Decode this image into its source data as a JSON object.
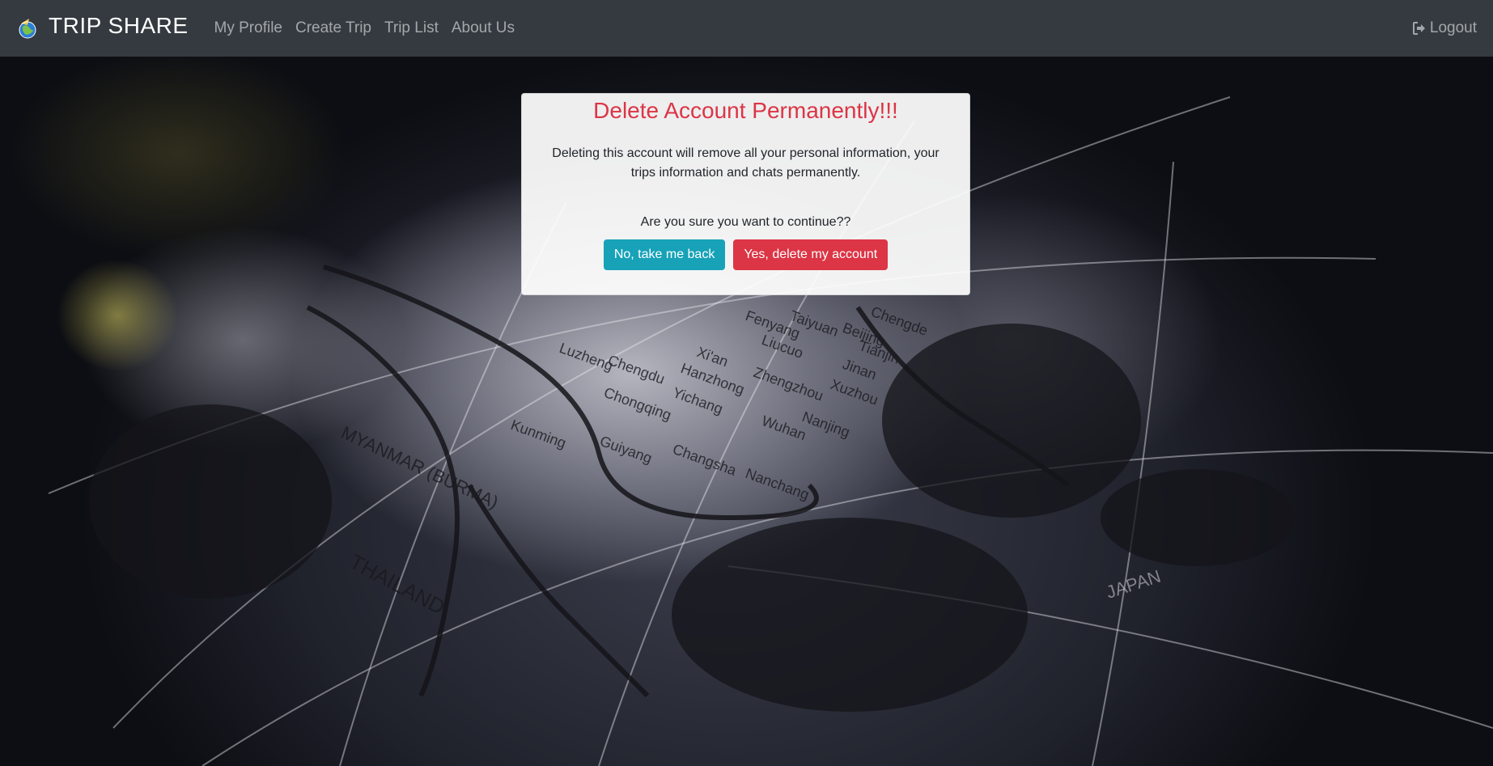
{
  "navbar": {
    "brand": "TRIP SHARE",
    "links": [
      {
        "label": "My Profile"
      },
      {
        "label": "Create Trip"
      },
      {
        "label": "Trip List"
      },
      {
        "label": "About Us"
      }
    ],
    "logout_label": "Logout",
    "logout_icon": "sign-out-icon",
    "background_color": "#343a40"
  },
  "dialog": {
    "title": "Delete Account Permanently!!!",
    "message": "Deleting this account will remove all your personal information, your trips information and chats permanently.",
    "question": "Are you sure you want to continue??",
    "cancel_label": "No, take me back",
    "confirm_label": "Yes, delete my account",
    "title_color": "#dc3545",
    "cancel_color": "#17a2b8",
    "confirm_color": "#dc3545"
  },
  "background": {
    "map_labels": [
      "Chengde",
      "Beijing",
      "Tianjin",
      "Taiyuan",
      "Fenyang",
      "Liucuo",
      "Xi'an",
      "Hanzhong",
      "Zhengzhou",
      "Jinan",
      "Xuzhou",
      "Nanjing",
      "Wuhan",
      "Yichang",
      "Chongqing",
      "Chengdu",
      "Luzheng",
      "Kunming",
      "Guiyang",
      "Changsha",
      "Nanchang",
      "MYANMAR (BURMA)",
      "THAILAND",
      "JAPAN"
    ]
  }
}
